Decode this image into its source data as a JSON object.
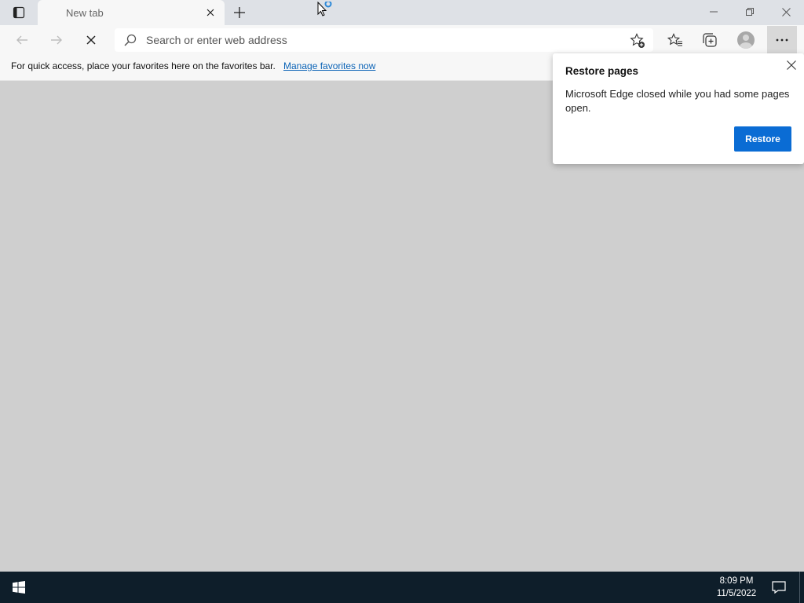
{
  "browser": {
    "tab": {
      "title": "New tab"
    },
    "address_bar": {
      "placeholder": "Search or enter web address",
      "value": ""
    }
  },
  "favorites_bar": {
    "message": "For quick access, place your favorites here on the favorites bar.",
    "link": "Manage favorites now"
  },
  "restore_popup": {
    "title": "Restore pages",
    "message": "Microsoft Edge closed while you had some pages open.",
    "button": "Restore"
  },
  "taskbar": {
    "time": "8:09 PM",
    "date": "11/5/2022"
  },
  "colors": {
    "accent": "#0a6cd4",
    "taskbar": "#0e1e2a",
    "content_bg": "#cfcfcf"
  },
  "icons": [
    "tab-actions-icon",
    "close-icon",
    "plus-icon",
    "minimize-icon",
    "restore-icon",
    "back-arrow-icon",
    "forward-arrow-icon",
    "stop-icon",
    "search-icon",
    "add-favorite-icon",
    "favorites-icon",
    "collections-icon",
    "profile-icon",
    "more-icon",
    "windows-logo-icon",
    "notification-icon",
    "cursor-icon"
  ]
}
